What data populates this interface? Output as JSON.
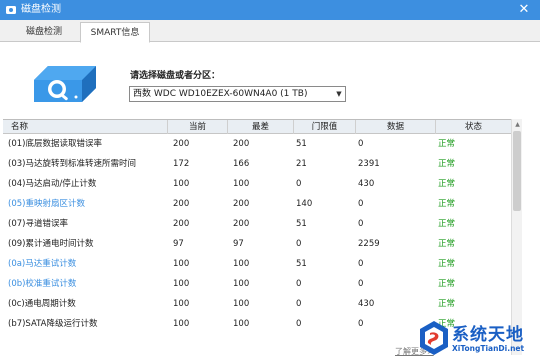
{
  "window": {
    "title": "磁盘检测"
  },
  "tabs": [
    {
      "label": "磁盘检测"
    },
    {
      "label": "SMART信息"
    }
  ],
  "selector": {
    "label": "请选择磁盘或者分区：",
    "value": "西数 WDC WD10EZEX-60WN4A0  (1 TB)"
  },
  "table": {
    "headers": [
      "名称",
      "当前",
      "最差",
      "门限值",
      "数据",
      "状态"
    ],
    "rows": [
      {
        "name": "(01)底层数据读取错误率",
        "current": "200",
        "worst": "200",
        "threshold": "51",
        "data": "0",
        "status": "正常",
        "highlight": false
      },
      {
        "name": "(03)马达旋转到标准转速所需时间",
        "current": "172",
        "worst": "166",
        "threshold": "21",
        "data": "2391",
        "status": "正常",
        "highlight": false
      },
      {
        "name": "(04)马达启动/停止计数",
        "current": "100",
        "worst": "100",
        "threshold": "0",
        "data": "430",
        "status": "正常",
        "highlight": false
      },
      {
        "name": "(05)重映射扇区计数",
        "current": "200",
        "worst": "200",
        "threshold": "140",
        "data": "0",
        "status": "正常",
        "highlight": true
      },
      {
        "name": "(07)寻道错误率",
        "current": "200",
        "worst": "200",
        "threshold": "51",
        "data": "0",
        "status": "正常",
        "highlight": false
      },
      {
        "name": "(09)累计通电时间计数",
        "current": "97",
        "worst": "97",
        "threshold": "0",
        "data": "2259",
        "status": "正常",
        "highlight": false
      },
      {
        "name": "(0a)马达重试计数",
        "current": "100",
        "worst": "100",
        "threshold": "51",
        "data": "0",
        "status": "正常",
        "highlight": true
      },
      {
        "name": "(0b)校准重试计数",
        "current": "100",
        "worst": "100",
        "threshold": "0",
        "data": "0",
        "status": "正常",
        "highlight": true
      },
      {
        "name": "(0c)通电周期计数",
        "current": "100",
        "worst": "100",
        "threshold": "0",
        "data": "430",
        "status": "正常",
        "highlight": false
      },
      {
        "name": "(b7)SATA降级运行计数",
        "current": "100",
        "worst": "100",
        "threshold": "0",
        "data": "0",
        "status": "正常",
        "highlight": false
      }
    ]
  },
  "footer": {
    "link": "了解更多>"
  },
  "watermark": {
    "title": "系统天地",
    "url": "XiTongTianDi.net"
  },
  "colors": {
    "titlebar": "#3d8fe0",
    "status_ok": "#1e9b1e",
    "attr_highlight": "#3b8fe0",
    "watermark": "#1a5fc4"
  },
  "icons": {
    "app": "disk-app-icon",
    "close": "close-icon",
    "disk": "disk-search-icon",
    "dropdown": "chevron-down-icon",
    "watermark": "watermark-logo-icon"
  }
}
